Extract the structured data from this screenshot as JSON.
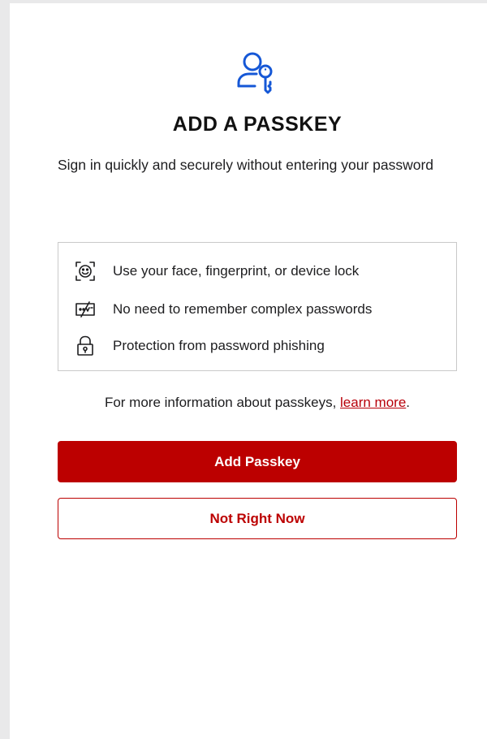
{
  "colors": {
    "brand_red": "#bc0000",
    "icon_blue": "#1557d6",
    "text": "#1d1d1f",
    "border": "#c9c9c9"
  },
  "hero": {
    "icon": "user-key-icon"
  },
  "title": "ADD A PASSKEY",
  "subtitle": "Sign in quickly and securely without entering your password",
  "features": [
    {
      "icon": "face-scan-icon",
      "text": "Use your face, fingerprint, or device lock"
    },
    {
      "icon": "password-dots-icon",
      "text": "No need to remember complex passwords"
    },
    {
      "icon": "padlock-icon",
      "text": "Protection from password phishing"
    }
  ],
  "info": {
    "prefix": "For more information about passkeys, ",
    "link_text": "learn more",
    "suffix": "."
  },
  "buttons": {
    "primary_label": "Add Passkey",
    "secondary_label": "Not Right Now"
  }
}
